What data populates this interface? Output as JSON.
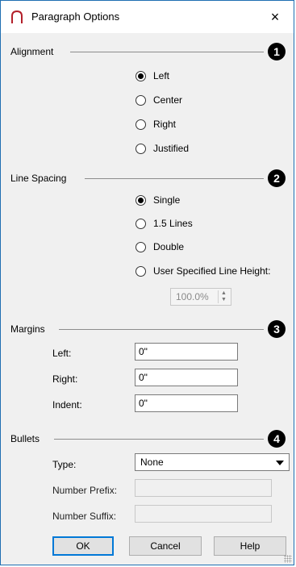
{
  "window": {
    "title": "Paragraph Options",
    "close_glyph": "×",
    "icon": "arc-icon"
  },
  "alignment": {
    "label": "Alignment",
    "badge": "1",
    "options": [
      "Left",
      "Center",
      "Right",
      "Justified"
    ],
    "selected": "Left"
  },
  "line_spacing": {
    "label": "Line Spacing",
    "badge": "2",
    "options": [
      "Single",
      "1.5 Lines",
      "Double",
      "User Specified Line Height:"
    ],
    "selected": "Single",
    "line_height_value": "100.0%"
  },
  "margins": {
    "label": "Margins",
    "badge": "3",
    "left_label": "Left:",
    "left_value": "0\"",
    "right_label": "Right:",
    "right_value": "0\"",
    "indent_label": "Indent:",
    "indent_value": "0\""
  },
  "bullets": {
    "label": "Bullets",
    "badge": "4",
    "type_label": "Type:",
    "type_value": "None",
    "prefix_label": "Number Prefix:",
    "prefix_value": "",
    "suffix_label": "Number Suffix:",
    "suffix_value": ""
  },
  "buttons": {
    "ok": "OK",
    "cancel": "Cancel",
    "help": "Help"
  },
  "colors": {
    "accent": "#0078d7",
    "dialog_bg": "#f0f0f0",
    "badge": "#000000"
  }
}
